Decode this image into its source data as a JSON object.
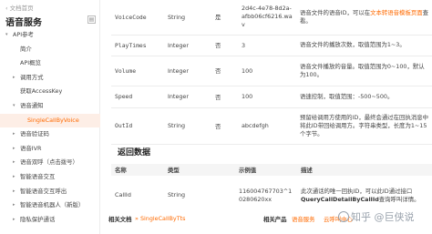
{
  "sidebar": {
    "back_label": "文档首页",
    "title": "语音服务",
    "items": [
      {
        "label": "API参考",
        "caret": "▾"
      },
      {
        "label": "简介"
      },
      {
        "label": "API概览"
      },
      {
        "label": "调用方式",
        "caret": "▸"
      },
      {
        "label": "获取AccessKey"
      },
      {
        "label": "语音通知",
        "caret": "▾"
      },
      {
        "label": "SingleCallByVoice"
      },
      {
        "label": "语音验证码",
        "caret": "▸"
      },
      {
        "label": "语音IVR",
        "caret": "▸"
      },
      {
        "label": "语音双呼（点击拨号）",
        "caret": "▸"
      },
      {
        "label": "智能语音交互",
        "caret": "▸"
      },
      {
        "label": "智能语音交互呼出",
        "caret": "▸"
      },
      {
        "label": "智能语音机器人（新版）",
        "caret": "▸"
      },
      {
        "label": "隐私保护通话",
        "caret": "▸"
      }
    ]
  },
  "params": [
    {
      "name": "VoiceCode",
      "type": "String",
      "required": "是",
      "example": "2d4c-4e78-8d2a-afbb06cf6216.wav",
      "desc_pre": "语音文件的语音ID，可以在",
      "desc_link": "文本转语音模板页面",
      "desc_post": "查看。"
    },
    {
      "name": "PlayTimes",
      "type": "Integer",
      "required": "否",
      "example": "3",
      "desc": "语音文件的播放次数，取值范围为1~3。"
    },
    {
      "name": "Volume",
      "type": "Integer",
      "required": "否",
      "example": "100",
      "desc": "语音文件播放的音量。取值范围为0~100，默认为100。"
    },
    {
      "name": "Speed",
      "type": "Integer",
      "required": "否",
      "example": "100",
      "desc": "语速控制，取值范围：-500~500。"
    },
    {
      "name": "OutId",
      "type": "String",
      "required": "否",
      "example": "abcdefgh",
      "desc": "预留给调用方使用的ID，最终会通过在回执消息中将此ID带回给调用方。字符串类型，长度为1~15个字节。"
    }
  ],
  "return_section": {
    "heading": "返回数据",
    "headers": [
      "名称",
      "类型",
      "示例值",
      "描述"
    ],
    "rows": [
      {
        "name": "CallId",
        "type": "String",
        "example": "116004767703^10280620xx",
        "desc_pre": "此次通话的唯一回执ID，可以此ID通过接口",
        "desc_bold": "QueryCallDetailByCallId",
        "desc_post": "查询呼叫详情。"
      }
    ]
  },
  "footer": {
    "docs_label": "相关文档",
    "docs_link": "SingleCallByTts",
    "products_label": "相关产品",
    "product_1": "语音服务",
    "product_2": "云呼叫中心"
  },
  "watermark": "知乎 @巨侠说",
  "colors": {
    "accent": "#ff6a00",
    "active_bg": "#fdeee6"
  }
}
